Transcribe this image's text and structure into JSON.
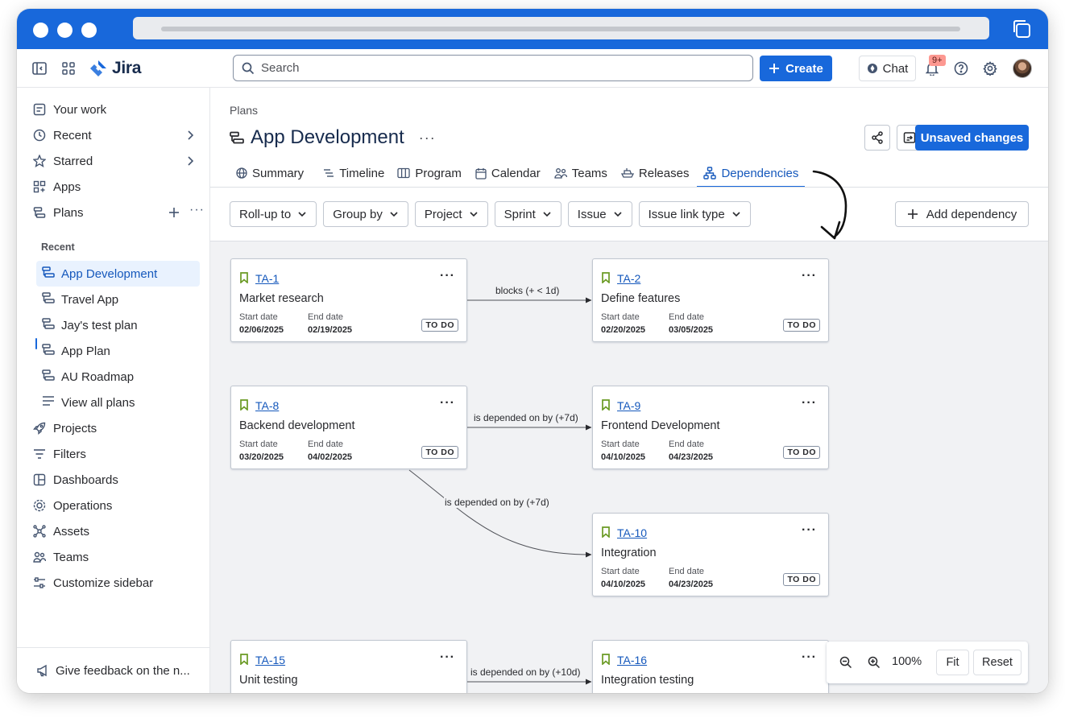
{
  "app": {
    "name": "Jira",
    "search_placeholder": "Search",
    "create_label": "Create",
    "chat_label": "Chat",
    "notification_badge": "9+"
  },
  "sidebar": {
    "items": [
      {
        "label": "Your work"
      },
      {
        "label": "Recent"
      },
      {
        "label": "Starred"
      },
      {
        "label": "Apps"
      },
      {
        "label": "Plans"
      }
    ],
    "recent_label": "Recent",
    "plans": [
      {
        "label": "App Development"
      },
      {
        "label": "Travel App"
      },
      {
        "label": "Jay's test plan"
      },
      {
        "label": "App Plan"
      },
      {
        "label": "AU Roadmap"
      },
      {
        "label": "View all plans"
      }
    ],
    "bottom_items": [
      {
        "label": "Projects"
      },
      {
        "label": "Filters"
      },
      {
        "label": "Dashboards"
      },
      {
        "label": "Operations"
      },
      {
        "label": "Assets"
      },
      {
        "label": "Teams"
      },
      {
        "label": "Customize sidebar"
      }
    ],
    "feedback_label": "Give feedback on the n..."
  },
  "page": {
    "breadcrumb": "Plans",
    "title": "App Development",
    "unsaved_label": "Unsaved changes",
    "tabs": [
      {
        "label": "Summary"
      },
      {
        "label": "Timeline"
      },
      {
        "label": "Program"
      },
      {
        "label": "Calendar"
      },
      {
        "label": "Teams"
      },
      {
        "label": "Releases"
      },
      {
        "label": "Dependencies"
      }
    ],
    "filters": [
      {
        "label": "Roll-up to"
      },
      {
        "label": "Group by"
      },
      {
        "label": "Project"
      },
      {
        "label": "Sprint"
      },
      {
        "label": "Issue"
      },
      {
        "label": "Issue link type"
      }
    ],
    "add_dependency_label": "Add dependency"
  },
  "card_labels": {
    "start": "Start date",
    "end": "End date"
  },
  "cards": [
    {
      "key": "TA-1",
      "name": "Market research",
      "start": "02/06/2025",
      "end": "02/19/2025",
      "status": "TO DO"
    },
    {
      "key": "TA-2",
      "name": "Define features",
      "start": "02/20/2025",
      "end": "03/05/2025",
      "status": "TO DO"
    },
    {
      "key": "TA-8",
      "name": "Backend development",
      "start": "03/20/2025",
      "end": "04/02/2025",
      "status": "TO DO"
    },
    {
      "key": "TA-9",
      "name": "Frontend Development",
      "start": "04/10/2025",
      "end": "04/23/2025",
      "status": "TO DO"
    },
    {
      "key": "TA-10",
      "name": "Integration",
      "start": "04/10/2025",
      "end": "04/23/2025",
      "status": "TO DO"
    },
    {
      "key": "TA-15",
      "name": "Unit testing",
      "start": "",
      "end": "",
      "status": ""
    },
    {
      "key": "TA-16",
      "name": "Integration testing",
      "start": "",
      "end": "",
      "status": ""
    }
  ],
  "edges": [
    {
      "label": "blocks (+ < 1d)"
    },
    {
      "label": "is depended on by (+7d)"
    },
    {
      "label": "is depended on by (+7d)"
    },
    {
      "label": "is depended on by (+10d)"
    }
  ],
  "zoom": {
    "level": "100%",
    "fit_label": "Fit",
    "reset_label": "Reset"
  },
  "colors": {
    "brand": "#1868db",
    "canvas_bg": "#f1f2f4",
    "link": "#1558bc",
    "bookmark": "#6a9a23"
  }
}
